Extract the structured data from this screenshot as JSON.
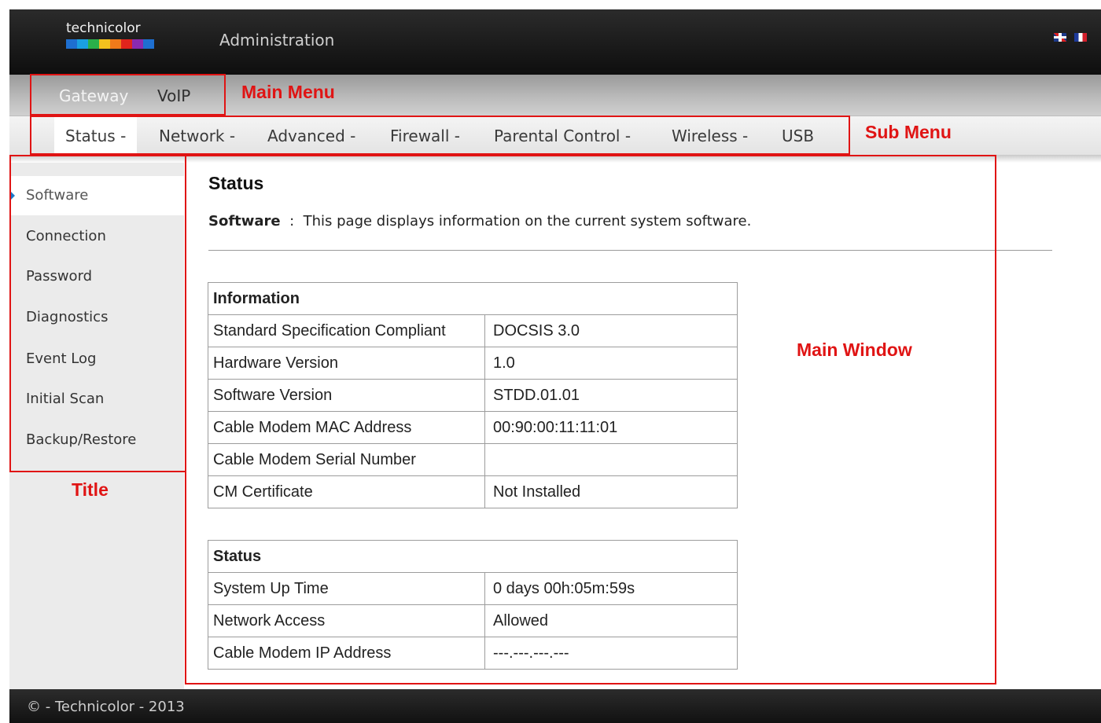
{
  "header": {
    "logo_text": "technicolor",
    "title": "Administration",
    "logo_colors": [
      "#1e6fd0",
      "#1aa0e0",
      "#2ab04a",
      "#f2c21e",
      "#f07a1a",
      "#e0241c",
      "#8a2ab0",
      "#1e6fd0"
    ]
  },
  "main_menu": {
    "items": [
      {
        "label": "Gateway",
        "active": true
      },
      {
        "label": "VoIP",
        "active": false
      }
    ]
  },
  "sub_menu": {
    "items": [
      {
        "label": "Status -",
        "active": true
      },
      {
        "label": "Network -"
      },
      {
        "label": "Advanced -"
      },
      {
        "label": "Firewall -"
      },
      {
        "label": "Parental Control -"
      },
      {
        "label": "Wireless -"
      },
      {
        "label": "USB"
      }
    ]
  },
  "sidebar": {
    "items": [
      {
        "label": "Software",
        "active": true
      },
      {
        "label": "Connection"
      },
      {
        "label": "Password"
      },
      {
        "label": "Diagnostics"
      },
      {
        "label": "Event Log"
      },
      {
        "label": "Initial Scan"
      },
      {
        "label": "Backup/Restore"
      }
    ]
  },
  "content": {
    "title": "Status",
    "desc_label": "Software",
    "desc_sep": ":",
    "desc_text": "This page displays information on the current system software.",
    "info_table": {
      "header": "Information",
      "rows": [
        [
          "Standard Specification Compliant",
          "DOCSIS 3.0"
        ],
        [
          "Hardware Version",
          "1.0"
        ],
        [
          "Software Version",
          "STDD.01.01"
        ],
        [
          "Cable Modem MAC Address",
          "00:90:00:11:11:01"
        ],
        [
          "Cable Modem Serial Number",
          ""
        ],
        [
          "CM Certificate",
          "Not Installed"
        ]
      ]
    },
    "status_table": {
      "header": "Status",
      "rows": [
        [
          "System Up Time",
          "0 days 00h:05m:59s"
        ],
        [
          "Network Access",
          "Allowed"
        ],
        [
          "Cable Modem IP Address",
          "---.---.---.---"
        ]
      ]
    }
  },
  "annotations": {
    "main_menu": "Main Menu",
    "sub_menu": "Sub Menu",
    "main_window": "Main Window",
    "title": "Title",
    "color": "#e01414"
  },
  "footer": {
    "text": "© - Technicolor - 2013"
  },
  "icons": {
    "flag_uk": "uk-flag-icon",
    "flag_fr": "fr-flag-icon",
    "sidebar_active": "arrow-right-icon"
  }
}
